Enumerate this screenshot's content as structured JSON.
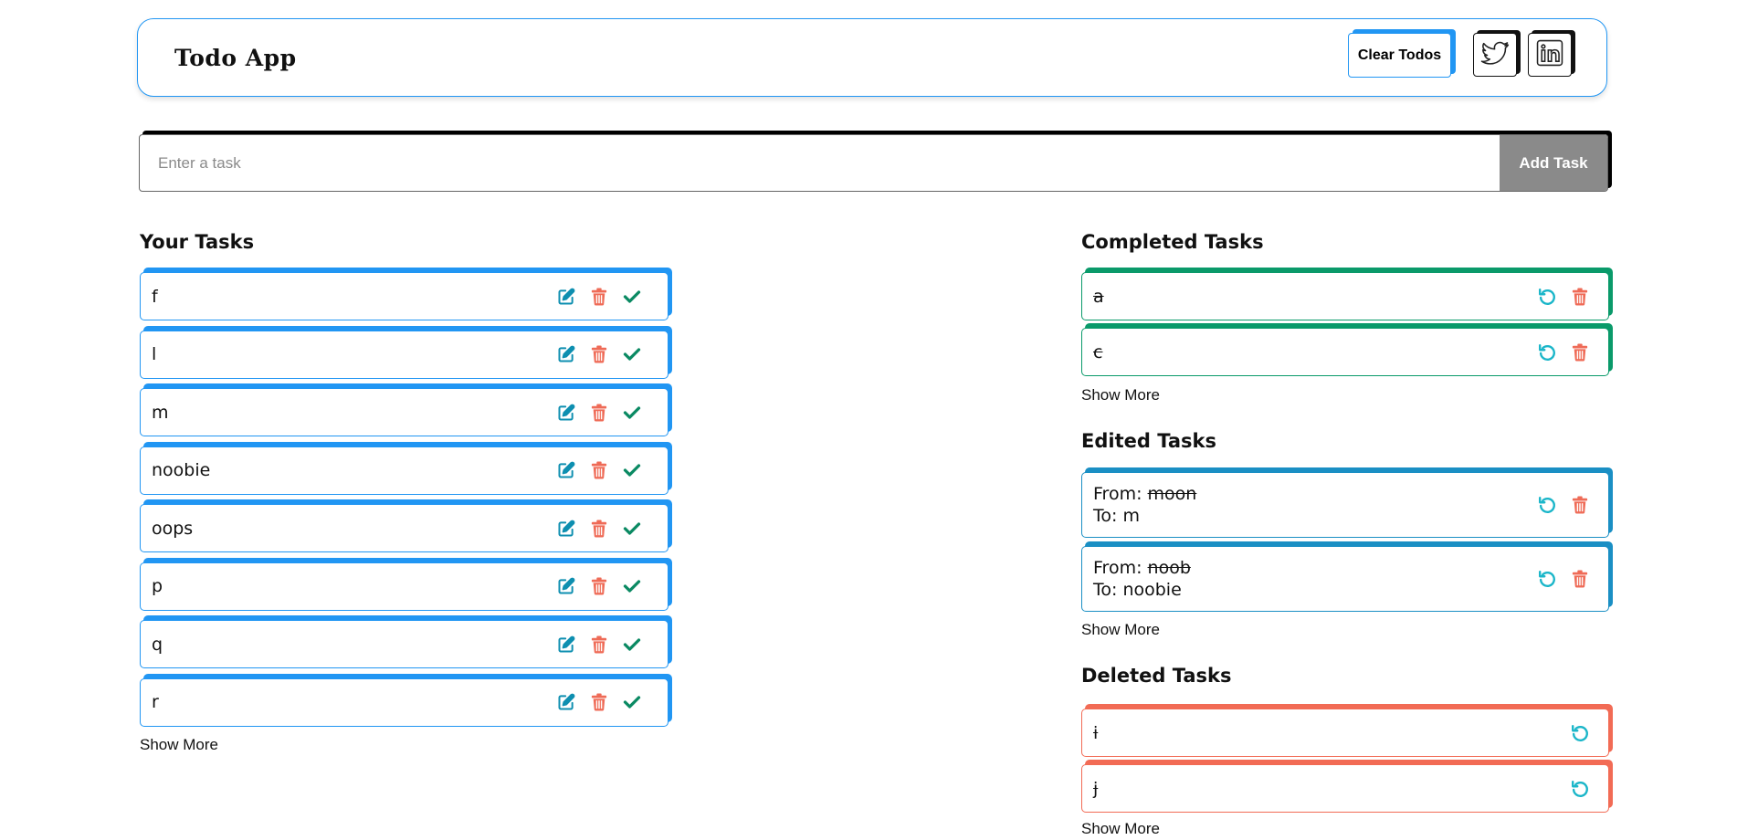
{
  "header": {
    "title": "Todo App",
    "clear_label": "Clear Todos",
    "twitter_icon": "twitter-icon",
    "linkedin_icon": "linkedin-icon"
  },
  "input": {
    "placeholder": "Enter a task",
    "value": "",
    "add_label": "Add Task"
  },
  "your_tasks": {
    "title": "Your Tasks",
    "items": [
      "f",
      "l",
      "m",
      "noobie",
      "oops",
      "p",
      "q",
      "r"
    ],
    "show_more": "Show More"
  },
  "completed_tasks": {
    "title": "Completed Tasks",
    "items": [
      "a",
      "c"
    ],
    "show_more": "Show More"
  },
  "edited_tasks": {
    "title": "Edited Tasks",
    "from_label": "From:",
    "to_label": "To:",
    "items": [
      {
        "from": "moon",
        "to": "m"
      },
      {
        "from": "noob",
        "to": "noobie"
      }
    ],
    "show_more": "Show More"
  },
  "deleted_tasks": {
    "title": "Deleted Tasks",
    "items": [
      "i",
      "j"
    ],
    "show_more": "Show More"
  },
  "colors": {
    "accent_blue": "#2196f3",
    "completed_green": "#0a9a6a",
    "edited_teal": "#1a8fc4",
    "deleted_red": "#f26b55",
    "edit_icon": "#0e8fb0",
    "trash_icon": "#ef6b57",
    "check_icon": "#0b8a63",
    "undo_icon": "#1bb6c9",
    "add_button_bg": "#8a8a8a"
  }
}
